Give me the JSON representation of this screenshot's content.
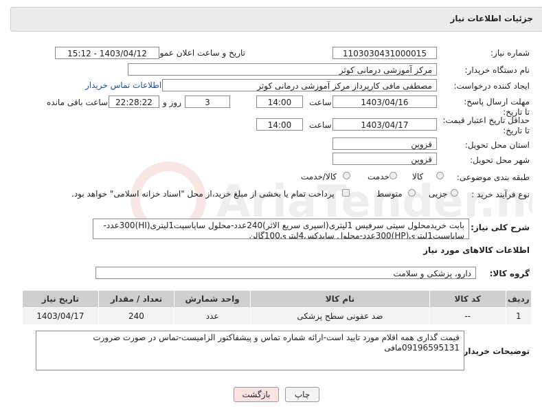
{
  "header": {
    "title": "جزئیات اطلاعات نیاز"
  },
  "form": {
    "need_number": {
      "label": "شماره نیاز:",
      "value": "1103030431000015"
    },
    "announce_datetime": {
      "label": "تاریخ و ساعت اعلان عمومی:",
      "value": "1403/04/12 - 15:12"
    },
    "buyer_org": {
      "label": "نام دستگاه خریدار:",
      "value": "مرکز آموزشی درمانی کوثر"
    },
    "requester": {
      "label": "ایجاد کننده درخواست:",
      "value": "مصطفی مافی کارپرداز مرکز آموزشی درمانی کوثر",
      "contact_link": "اطلاعات تماس خریدار"
    },
    "reply_deadline": {
      "label": "مهلت ارسال پاسخ: تا تاریخ:",
      "date": "1403/04/16",
      "time_label": "ساعت",
      "time": "14:00",
      "days": "3",
      "days_label": "روز و",
      "remaining_time": "22:28:22",
      "remaining_label": "ساعت باقی مانده"
    },
    "price_validity": {
      "label": "حداقل تاریخ اعتبار قیمت: تا تاریخ:",
      "date": "1403/04/17",
      "time_label": "ساعت",
      "time": "14:00"
    },
    "province": {
      "label": "استان محل تحویل:",
      "value": "قزوین"
    },
    "city": {
      "label": "شهر محل تحویل:",
      "value": "قزوین"
    },
    "category": {
      "label": "طبقه بندی موضوعی:",
      "options": [
        "کالا",
        "خدمت",
        "کالا/خدمت"
      ]
    },
    "process_type": {
      "label": "نوع فرآیند خرید :",
      "options": [
        "جزیی",
        "متوسط"
      ],
      "note": "پرداخت تمام یا بخشی از مبلغ خرید،از محل \"اسناد خزانه اسلامی\" خواهد بود."
    }
  },
  "description": {
    "label": "شرح کلی نیاز:",
    "text": "بابت خریدمحلول سیتی سرفیس 1لیتری(اسپری سریع الاثر)240عدد-محلول ساپاسپت1لیتری(HI)300عدد-ساپاسپت1لیتری(HP)300عدد-محلول سایدکس4لیتری100گالن"
  },
  "goods": {
    "section_title": "اطلاعات کالاهای مورد نیاز",
    "group_label": "گروه کالا:",
    "group_value": "دارو، پزشکی و سلامت",
    "columns": [
      "ردیف",
      "کد کالا",
      "نام کالا",
      "واحد شمارش",
      "تعداد / مقدار",
      "تاریخ نیاز"
    ],
    "rows": [
      {
        "row": "1",
        "code": "--",
        "name": "ضد عفونی سطح پزشکی",
        "unit": "عدد",
        "qty": "240",
        "date": "1403/04/17"
      }
    ]
  },
  "buyer_notes": {
    "label": "توضیحات خریدار:",
    "text": "قیمت گذاری همه اقلام مورد تایید است-ارائه شماره تماس و پیشفاکتور الزامیست-تماس در صورت ضرورت 09196595131مافی"
  },
  "buttons": {
    "print": "چاپ",
    "back": "بازگشت"
  },
  "watermark": "AriaTender.neT"
}
